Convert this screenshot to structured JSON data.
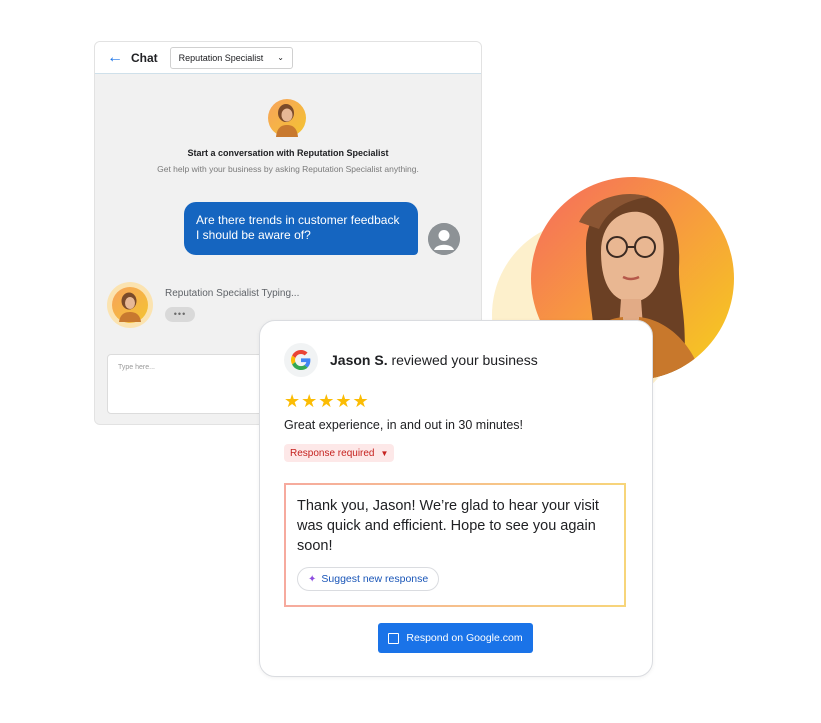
{
  "chat": {
    "back_icon": "back-arrow-icon",
    "title": "Chat",
    "agent_select": "Reputation Specialist",
    "intro_title": "Start a conversation with Reputation Specialist",
    "intro_subtitle": "Get help with your business by asking Reputation Specialist anything.",
    "user_message": "Are there trends in customer feedback I should be aware of?",
    "typing_label": "Reputation Specialist Typing...",
    "typing_dots": "•••",
    "input_placeholder": "Type here..."
  },
  "review": {
    "reviewer_name": "Jason S.",
    "reviewer_action": "reviewed your business",
    "stars": "★★★★★",
    "rating": 5,
    "review_text": "Great experience, in and out in 30 minutes!",
    "badge": "Response required",
    "reply_text": "Thank you, Jason! We’re glad to hear your visit was quick and efficient. Hope to see you again soon!",
    "suggest_label": "Suggest new response",
    "respond_label": "Respond on Google.com"
  },
  "colors": {
    "accent": "#1a73e8",
    "user_bubble": "#1565c0",
    "star": "#fbbc04",
    "badge_text": "#c5221f",
    "badge_bg": "#fde8e8"
  }
}
